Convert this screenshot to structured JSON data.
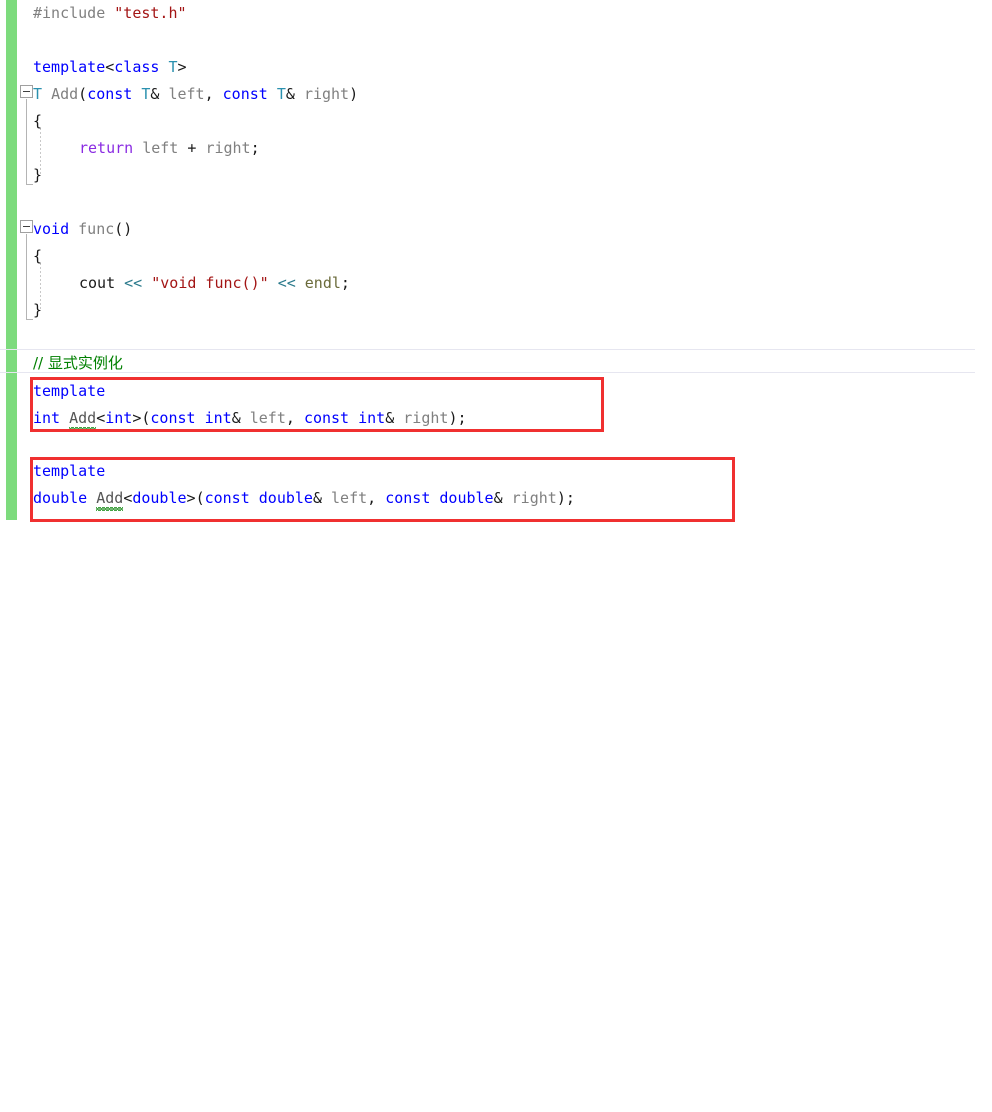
{
  "editor": {
    "language": "C++",
    "background": "#ffffff",
    "change_bar_color": "#7ddb7d",
    "annotation_color": "#f03030",
    "colors": {
      "keyword": "#0000ff",
      "type": "#2b91af",
      "string": "#a31515",
      "comment": "#008000",
      "plain": "#808080",
      "operator": "#2b7a8c",
      "text": "#1a1a1a",
      "squiggle": "#3a9d3a",
      "highlight_band": "#e6e6f0"
    }
  },
  "code": {
    "line_01": {
      "include": "#include",
      "header": "\"test.h\""
    },
    "line_03": {
      "template": "template",
      "lt": "<",
      "class": "class",
      "T": "T",
      "gt": ">"
    },
    "line_04": {
      "ret": "T",
      "sp": " ",
      "name": "Add",
      "open": "(",
      "const1": "const",
      "t1": "T",
      "amp1": "&",
      "left": "left",
      "comma": ", ",
      "const2": "const",
      "t2": "T",
      "amp2": "&",
      "right": "right",
      "close": ")"
    },
    "line_05": "{",
    "line_06": {
      "return": "return",
      "left": "left",
      "plus": "+",
      "right": "right",
      "semi": ";"
    },
    "line_07": "}",
    "line_09": {
      "void": "void",
      "name": "func",
      "parens": "()"
    },
    "line_10": "{",
    "line_11": {
      "cout": "cout",
      "shift1": "<<",
      "string": "\"void func()\"",
      "shift2": "<<",
      "endl": "endl",
      "semi": ";"
    },
    "line_12": "}",
    "line_14_comment": "// 显式实例化",
    "line_15": "template",
    "line_16": {
      "ret": "int",
      "name": "Add",
      "lt": "<",
      "arg": "int",
      "gt": ">",
      "open": "(",
      "const1": "const",
      "t1": "int",
      "amp1": "&",
      "left": "left",
      "comma": ", ",
      "const2": "const",
      "t2": "int",
      "amp2": "&",
      "right": "right",
      "close": ");"
    },
    "line_18": "template",
    "line_19": {
      "ret": "double",
      "name": "Add",
      "lt": "<",
      "arg": "double",
      "gt": ">",
      "open": "(",
      "const1": "const",
      "t1": "double",
      "amp1": "&",
      "left": "left",
      "comma": ", ",
      "const2": "const",
      "t2": "double",
      "amp2": "&",
      "right": "right",
      "close": ");"
    }
  }
}
